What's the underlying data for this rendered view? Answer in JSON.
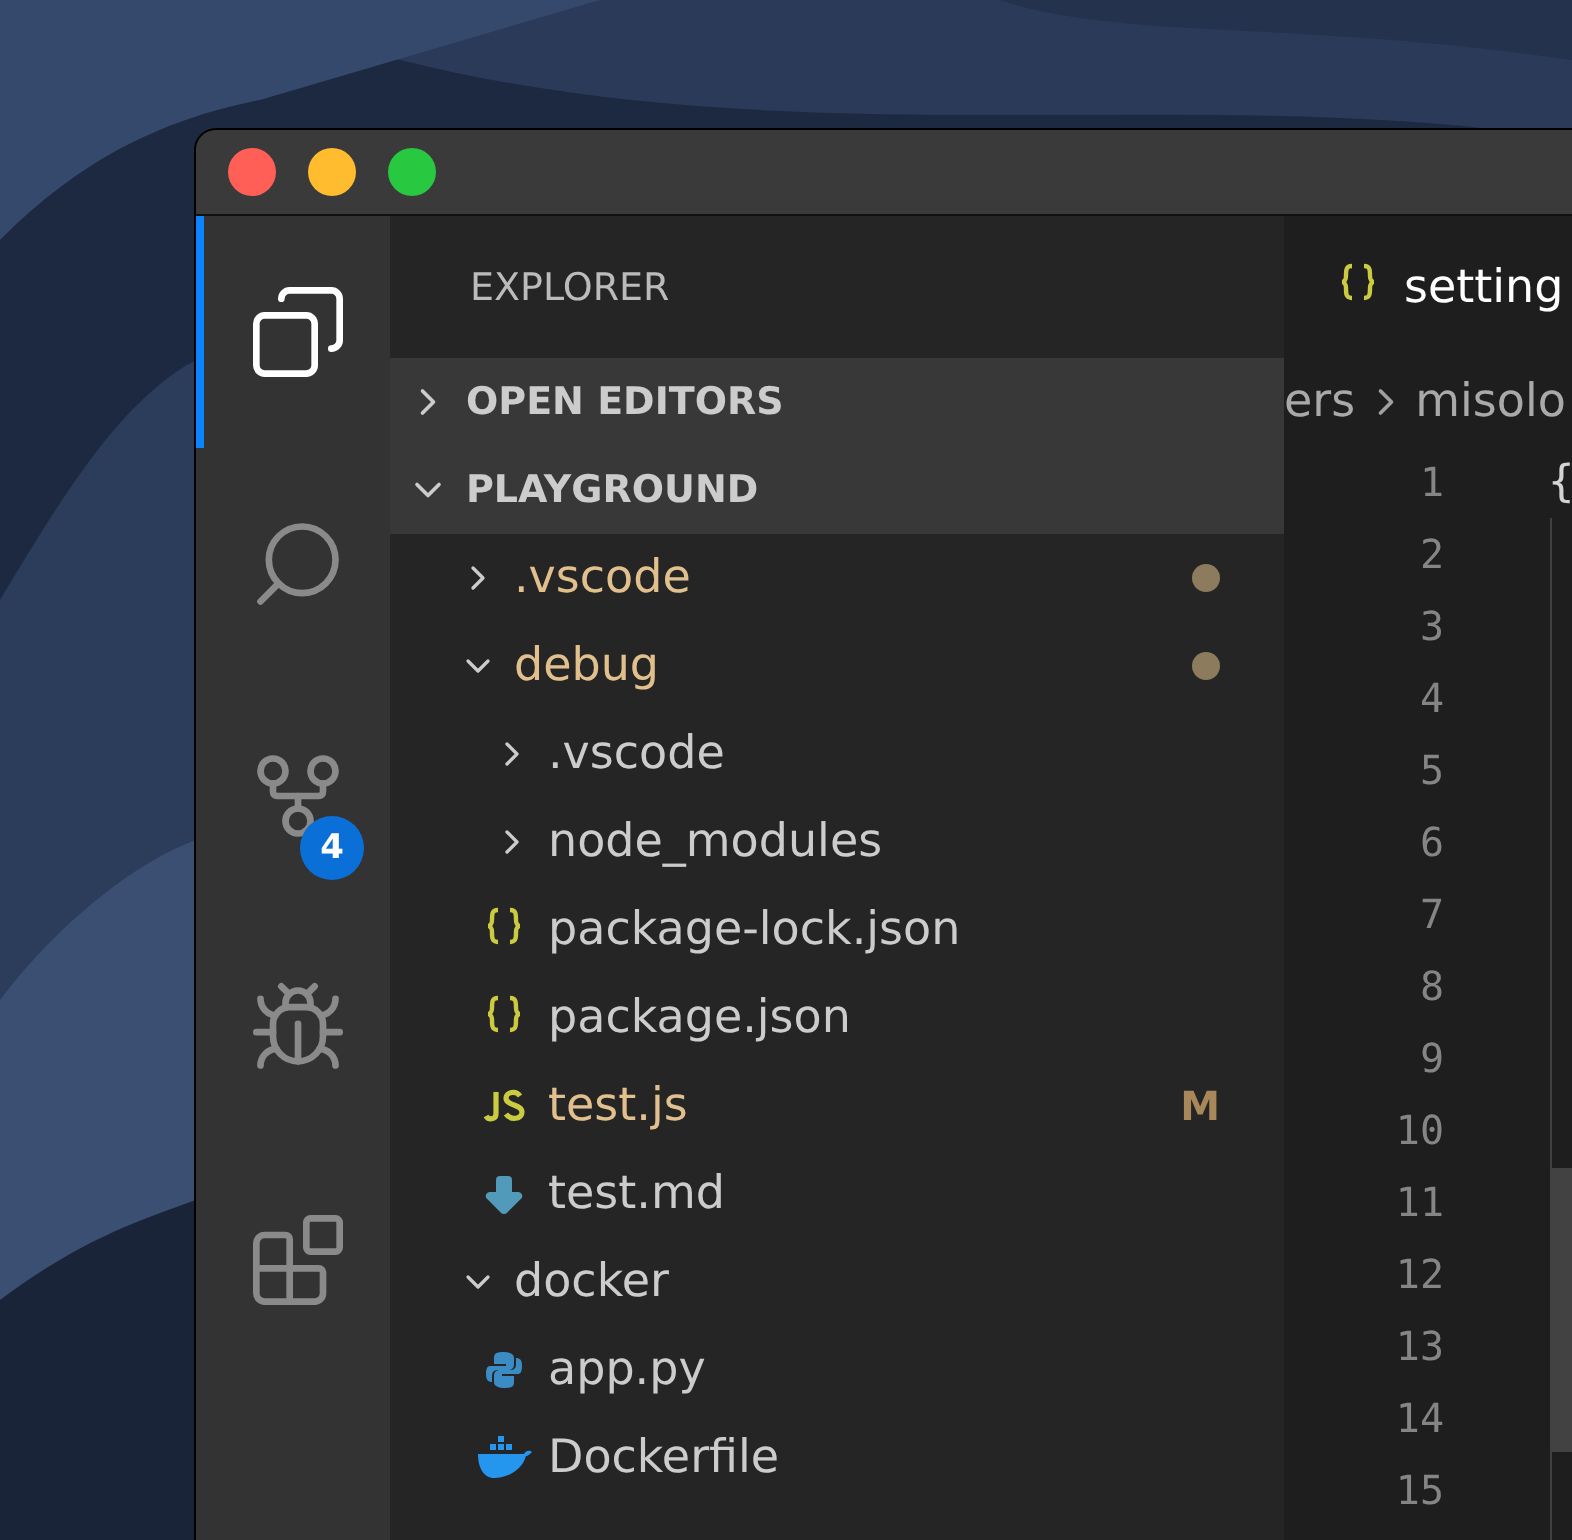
{
  "activity_bar": [
    {
      "kind": "files",
      "selected": true
    },
    {
      "kind": "search",
      "selected": false
    },
    {
      "kind": "source-control",
      "selected": false,
      "badge": "4"
    },
    {
      "kind": "debug",
      "selected": false
    },
    {
      "kind": "extensions",
      "selected": false
    }
  ],
  "sidebar": {
    "title": "EXPLORER",
    "sections": [
      {
        "label": "OPEN EDITORS",
        "expanded": false
      },
      {
        "label": "PLAYGROUND",
        "expanded": true,
        "children": [
          {
            "name": ".vscode",
            "kind": "folder",
            "expanded": false,
            "modified": true,
            "dot": true
          },
          {
            "name": "debug",
            "kind": "folder",
            "expanded": true,
            "modified": true,
            "dot": true,
            "children": [
              {
                "name": ".vscode",
                "kind": "folder",
                "expanded": false,
                "modified": false,
                "dot": false
              },
              {
                "name": "node_modules",
                "kind": "folder",
                "expanded": false,
                "modified": false,
                "dot": false
              },
              {
                "name": "package-lock.json",
                "kind": "json",
                "modified": false,
                "dot": false
              },
              {
                "name": "package.json",
                "kind": "json",
                "modified": false,
                "dot": false
              },
              {
                "name": "test.js",
                "kind": "js",
                "modified": true,
                "dot": false,
                "badge": "M"
              },
              {
                "name": "test.md",
                "kind": "markdown",
                "modified": false,
                "dot": false
              }
            ]
          },
          {
            "name": "docker",
            "kind": "folder",
            "expanded": true,
            "modified": false,
            "dot": false,
            "children": [
              {
                "name": "app.py",
                "kind": "python",
                "modified": false,
                "dot": false
              },
              {
                "name": "Dockerfile",
                "kind": "docker",
                "modified": false,
                "dot": false
              }
            ]
          }
        ]
      }
    ]
  },
  "editor": {
    "tab": {
      "label": "setting",
      "kind": "json"
    },
    "breadcrumb": [
      "ers",
      "misolo"
    ],
    "lines": [
      {
        "number": "1",
        "text": "{"
      },
      {
        "number": "2"
      },
      {
        "number": "3"
      },
      {
        "number": "4"
      },
      {
        "number": "5"
      },
      {
        "number": "6"
      },
      {
        "number": "7"
      },
      {
        "number": "8"
      },
      {
        "number": "9"
      },
      {
        "number": "10"
      },
      {
        "number": "11"
      },
      {
        "number": "12"
      },
      {
        "number": "13"
      },
      {
        "number": "14"
      },
      {
        "number": "15"
      }
    ]
  }
}
